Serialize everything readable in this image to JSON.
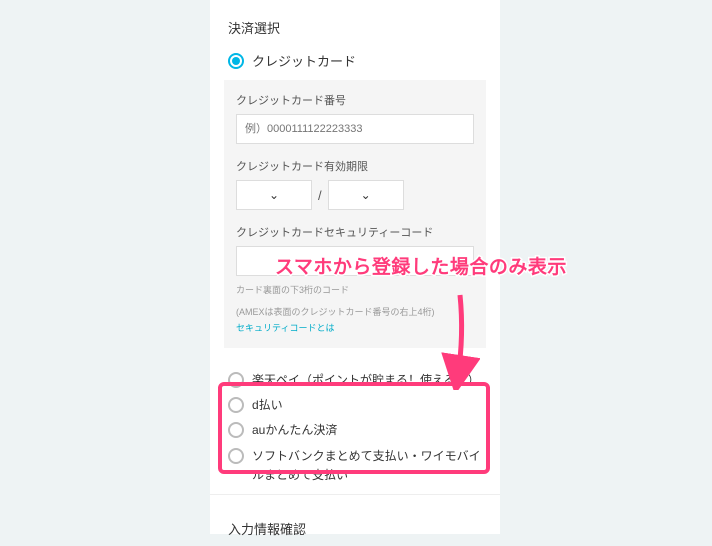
{
  "section_title": "決済選択",
  "credit_card_label": "クレジットカード",
  "card_box": {
    "number_label": "クレジットカード番号",
    "number_placeholder": "例）0000111122223333",
    "expiry_label": "クレジットカード有効期限",
    "slash": "/",
    "cvv_label": "クレジットカードセキュリティーコード",
    "help1": "カード裏面の下3桁のコード",
    "help2": "(AMEXは表面のクレジットカード番号の右上4桁)",
    "help_link": "セキュリティコードとは"
  },
  "options": {
    "rakuten": "楽天ペイ（ポイントが貯まる！使える！）",
    "d": "d払い",
    "au": "auかんたん決済",
    "softbank": "ソフトバンクまとめて支払い・ワイモバイルまとめて支払い"
  },
  "confirm_title": "入力情報確認",
  "annotation": "スマホから登録した場合のみ表示"
}
